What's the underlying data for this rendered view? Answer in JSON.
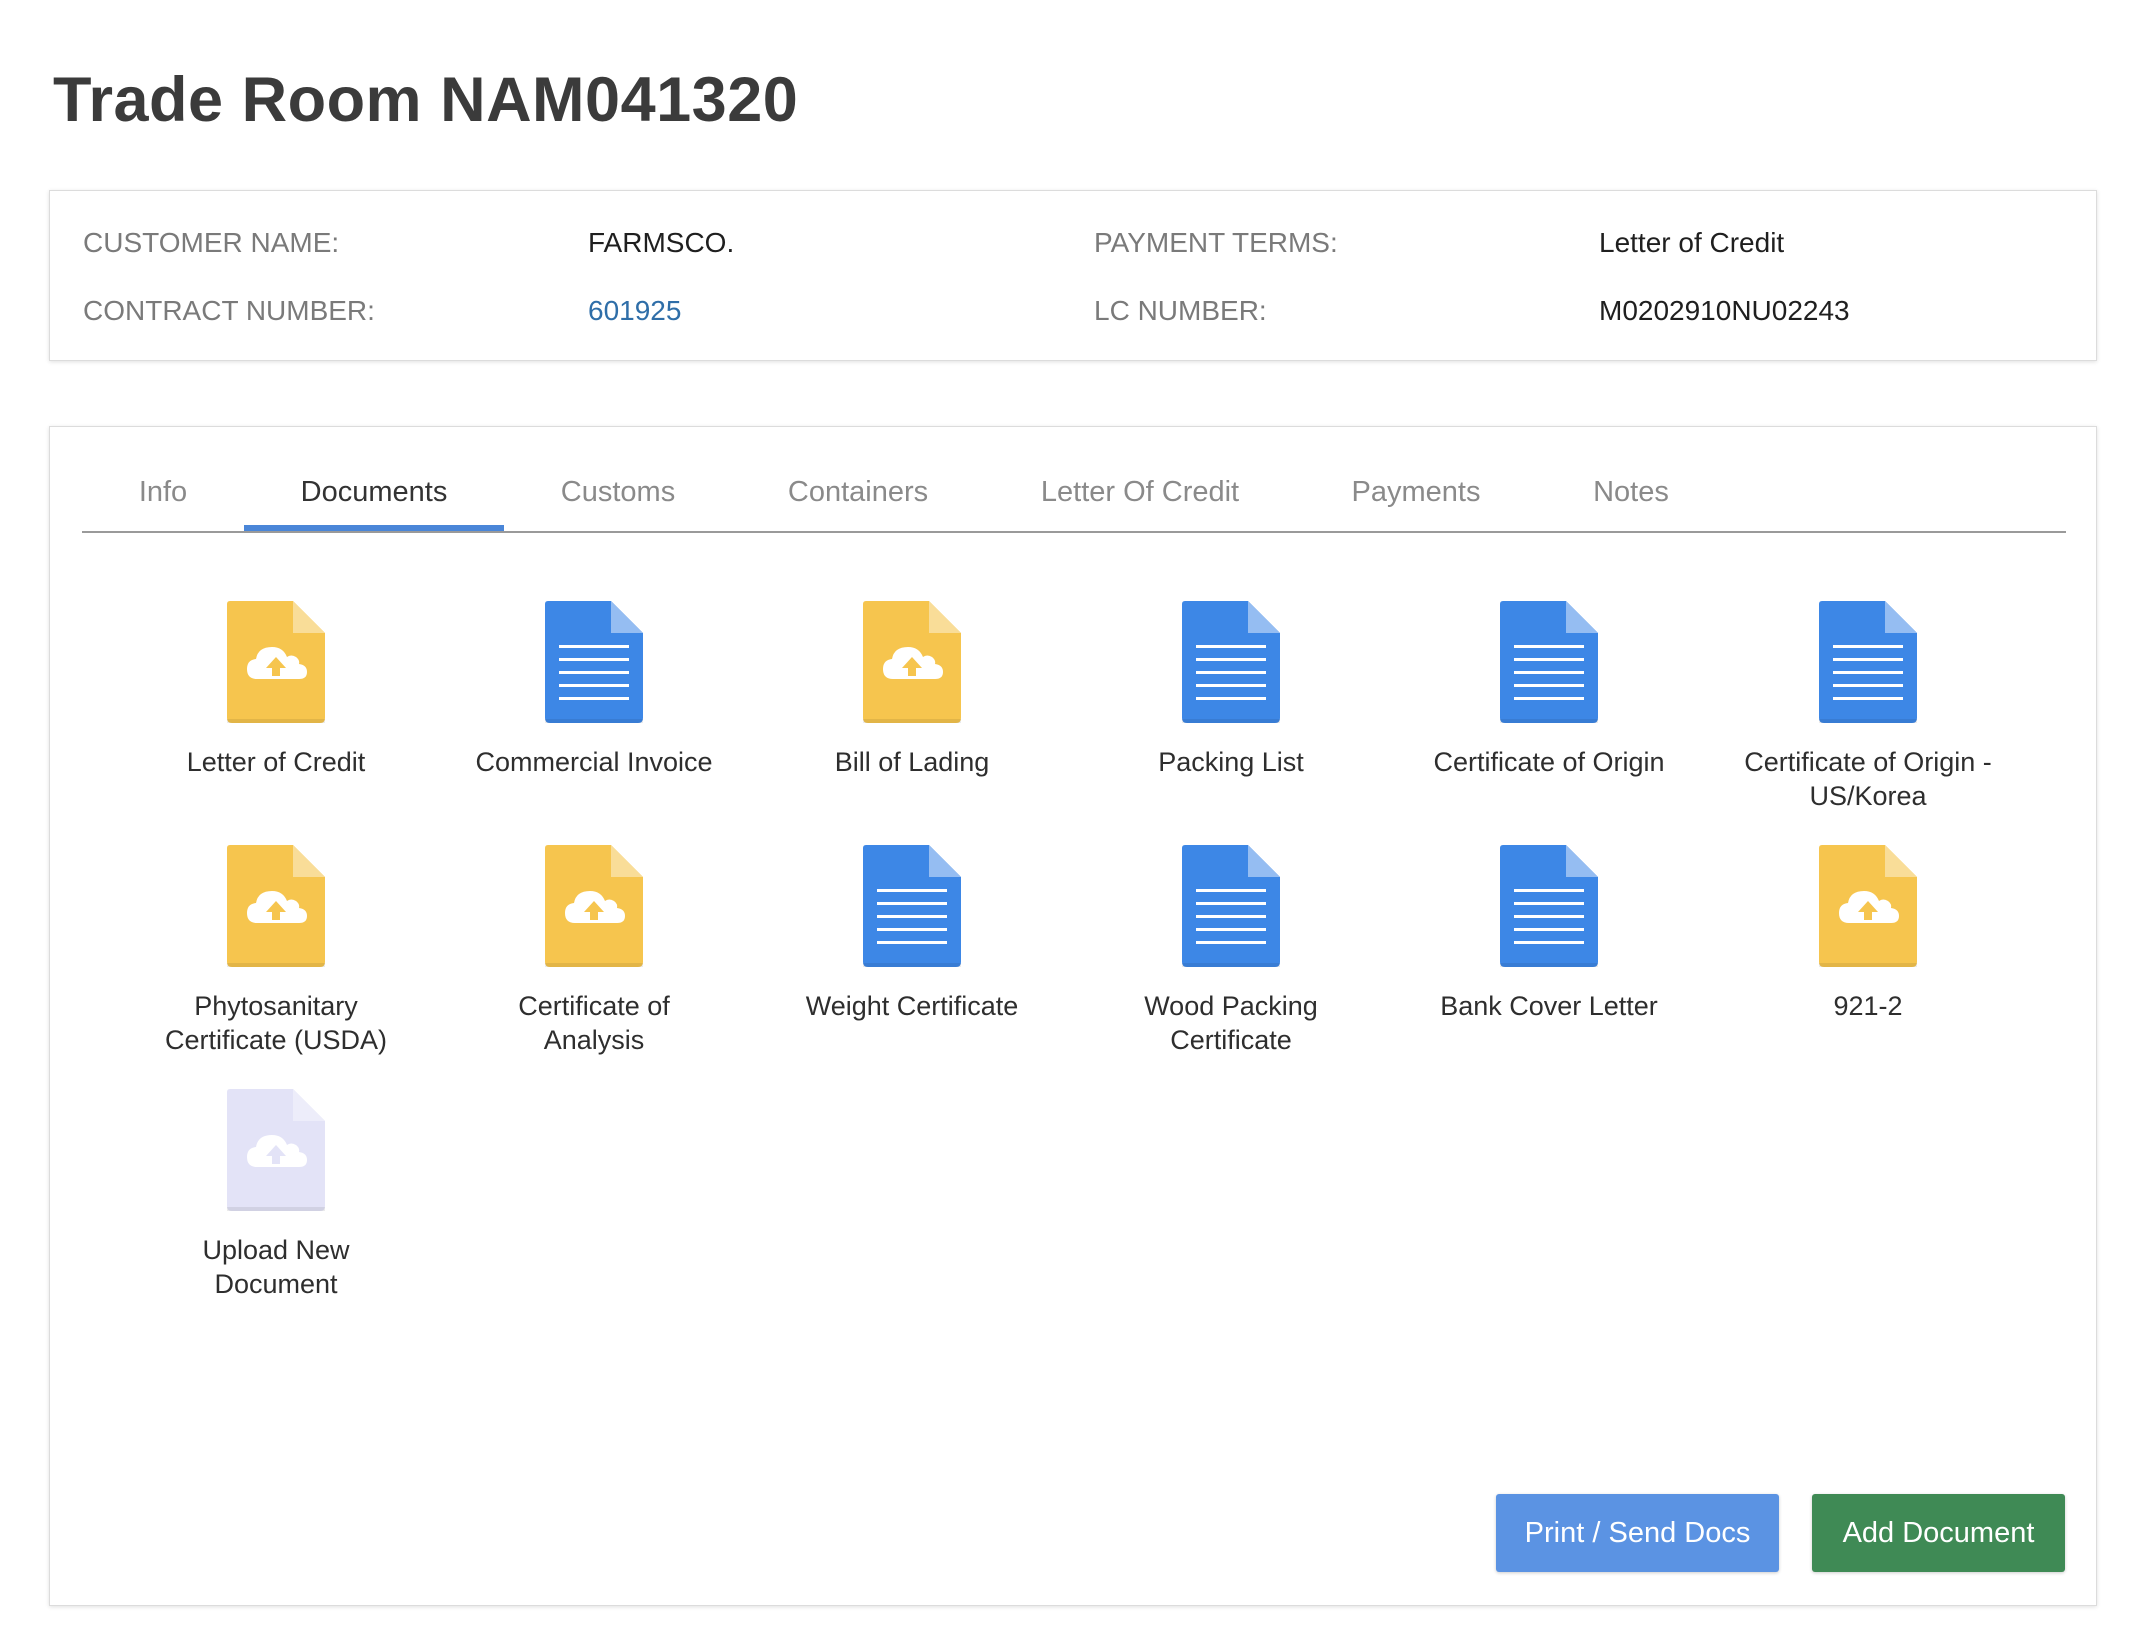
{
  "page": {
    "title": "Trade Room NAM041320"
  },
  "info": {
    "customer_name_label": "CUSTOMER NAME:",
    "customer_name": "FARMSCO.",
    "payment_terms_label": "PAYMENT TERMS:",
    "payment_terms": "Letter of Credit",
    "contract_number_label": "CONTRACT NUMBER:",
    "contract_number": "601925",
    "lc_number_label": "LC NUMBER:",
    "lc_number": "M0202910NU02243"
  },
  "tabs": [
    {
      "label": "Info"
    },
    {
      "label": "Documents",
      "active": true
    },
    {
      "label": "Customs"
    },
    {
      "label": "Containers"
    },
    {
      "label": "Letter Of Credit"
    },
    {
      "label": "Payments"
    },
    {
      "label": "Notes"
    }
  ],
  "documents": [
    {
      "label": "Letter of Credit",
      "icon": "upload-document-icon"
    },
    {
      "label": "Commercial Invoice",
      "icon": "document-icon"
    },
    {
      "label": "Bill of Lading",
      "icon": "upload-document-icon"
    },
    {
      "label": "Packing List",
      "icon": "document-icon"
    },
    {
      "label": "Certificate of Origin",
      "icon": "document-icon"
    },
    {
      "label": "Certificate of Origin - US/Korea",
      "icon": "document-icon"
    },
    {
      "label": "Phytosanitary Certificate (USDA)",
      "icon": "upload-document-icon"
    },
    {
      "label": "Certificate of Analysis",
      "icon": "upload-document-icon"
    },
    {
      "label": "Weight Certificate",
      "icon": "document-icon"
    },
    {
      "label": "Wood Packing Certificate",
      "icon": "document-icon"
    },
    {
      "label": "Bank Cover Letter",
      "icon": "document-icon"
    },
    {
      "label": "921-2",
      "icon": "upload-document-icon"
    },
    {
      "label": "Upload New Document",
      "icon": "upload-new-document-icon"
    }
  ],
  "buttons": {
    "print_label": "Print / Send Docs",
    "add_label": "Add Document"
  },
  "colors": {
    "pending_doc": "#f6c54e",
    "pending_doc_fold": "#f9dd98",
    "completed_doc": "#3d87e6",
    "completed_doc_fold": "#95bdf2",
    "new_doc": "#e3e3f7",
    "new_doc_fold": "#ededfa",
    "active_tab": "#4a86d8",
    "link": "#2f6ea8",
    "print_button": "#5b93e3",
    "add_button": "#3f8a55"
  }
}
